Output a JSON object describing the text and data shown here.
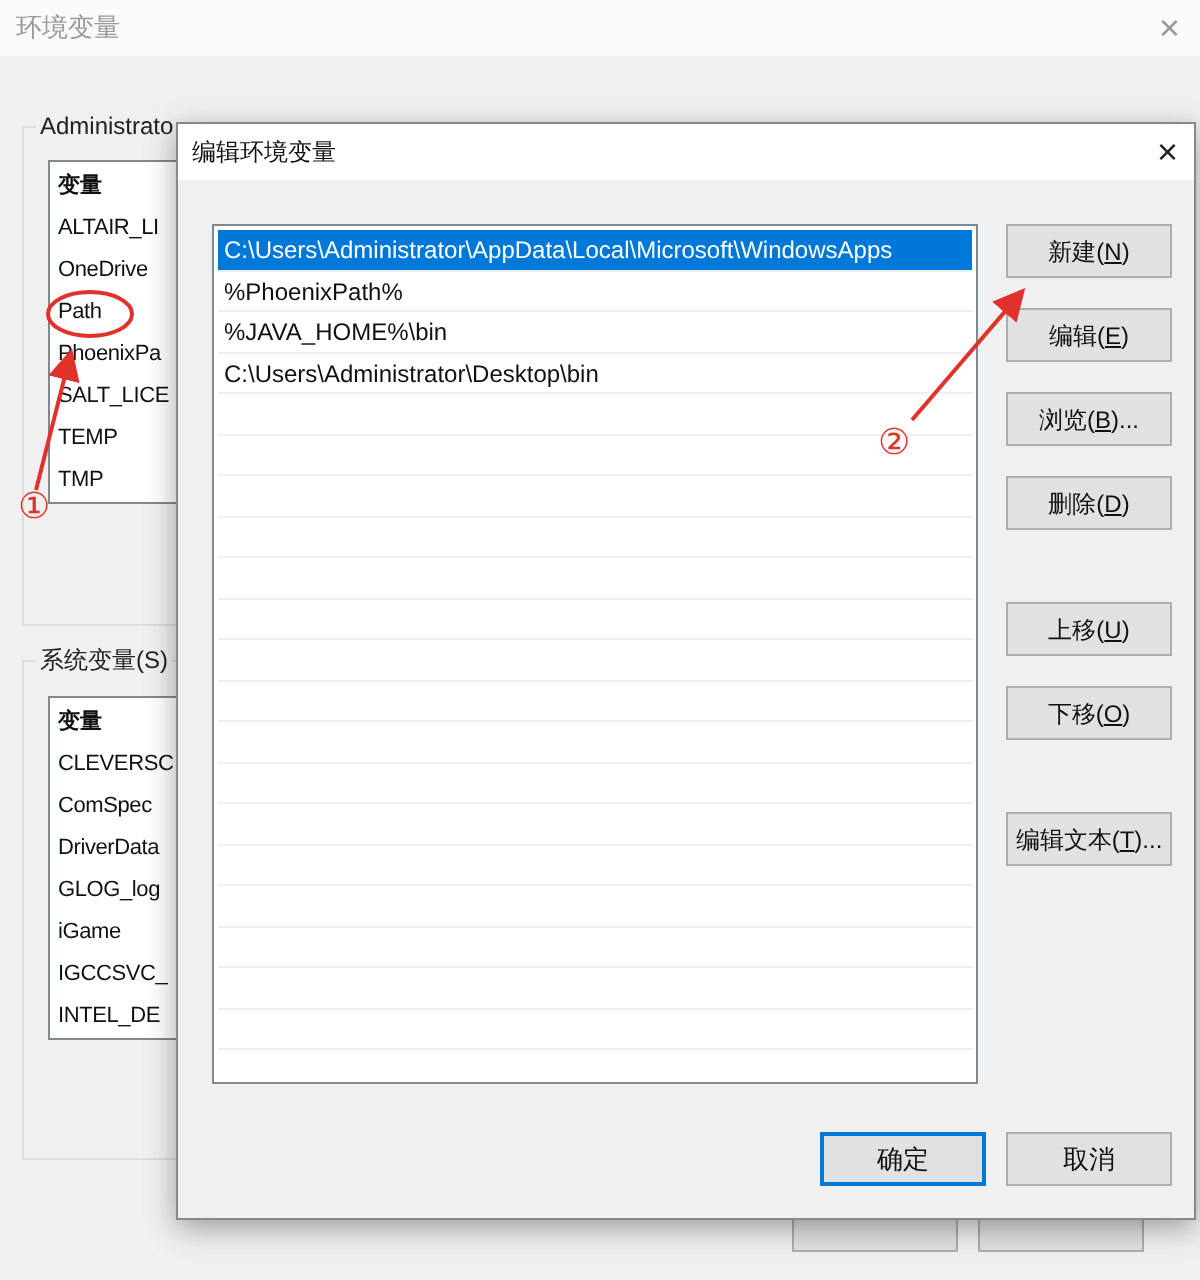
{
  "window": {
    "title": "环境变量",
    "close": "×"
  },
  "user_group": {
    "label": "Administrato",
    "items": [
      {
        "text": "变量"
      },
      {
        "text": "ALTAIR_LI"
      },
      {
        "text": "OneDrive"
      },
      {
        "text": "Path"
      },
      {
        "text": "PhoenixPa"
      },
      {
        "text": "SALT_LICE"
      },
      {
        "text": "TEMP"
      },
      {
        "text": "TMP"
      }
    ]
  },
  "system_group": {
    "label": "系统变量(S)",
    "items": [
      {
        "text": "变量"
      },
      {
        "text": "CLEVERSC"
      },
      {
        "text": "ComSpec"
      },
      {
        "text": "DriverData"
      },
      {
        "text": "GLOG_log"
      },
      {
        "text": "iGame"
      },
      {
        "text": "IGCCSVC_"
      },
      {
        "text": "INTEL_DE"
      }
    ]
  },
  "dialog": {
    "title": "编辑环境变量",
    "close": "×",
    "paths": [
      {
        "text": "C:\\Users\\Administrator\\AppData\\Local\\Microsoft\\WindowsApps",
        "selected": true
      },
      {
        "text": "%PhoenixPath%",
        "selected": false
      },
      {
        "text": "%JAVA_HOME%\\bin",
        "selected": false
      },
      {
        "text": "C:\\Users\\Administrator\\Desktop\\bin",
        "selected": false
      }
    ],
    "button_groups": [
      [
        {
          "before": "新建(",
          "key": "N",
          "after": ")"
        },
        {
          "before": "编辑(",
          "key": "E",
          "after": ")"
        },
        {
          "before": "浏览(",
          "key": "B",
          "after": ")..."
        },
        {
          "before": "删除(",
          "key": "D",
          "after": ")"
        }
      ],
      [
        {
          "before": "上移(",
          "key": "U",
          "after": ")"
        },
        {
          "before": "下移(",
          "key": "O",
          "after": ")"
        }
      ],
      [
        {
          "before": "编辑文本(",
          "key": "T",
          "after": ")..."
        }
      ]
    ],
    "footer": [
      {
        "label": "确定",
        "focused": true
      },
      {
        "label": "取消",
        "focused": false
      }
    ]
  },
  "annotations": [
    {
      "label": "①"
    },
    {
      "label": "②"
    }
  ]
}
